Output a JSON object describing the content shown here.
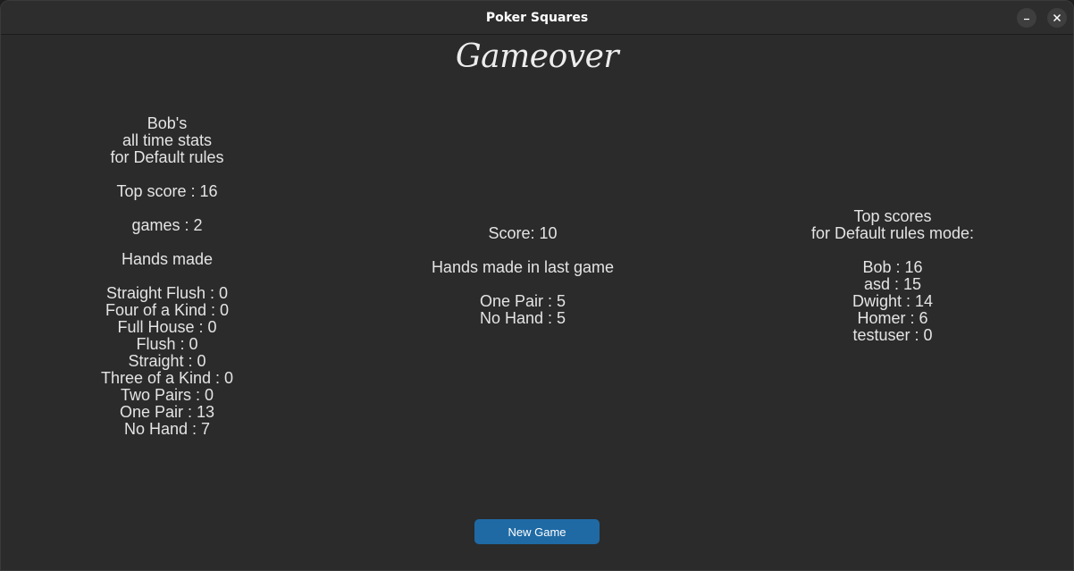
{
  "window": {
    "title": "Poker Squares"
  },
  "heading": "Gameover",
  "stats": {
    "header": [
      "Bob's",
      "all time stats",
      "for Default rules"
    ],
    "top_score": "Top score : 16",
    "games": "games : 2",
    "hands_made_label": "Hands made",
    "hands": [
      "Straight Flush : 0",
      "Four of a Kind : 0",
      "Full House : 0",
      "Flush : 0",
      "Straight : 0",
      "Three of a Kind : 0",
      "Two Pairs : 0",
      "One Pair : 13",
      "No Hand : 7"
    ]
  },
  "last_game": {
    "score": "Score: 10",
    "hands_label": "Hands made in last game",
    "hands": [
      "One Pair : 5",
      "No Hand : 5"
    ]
  },
  "top_scores": {
    "header": [
      "Top scores",
      "for Default rules mode:"
    ],
    "entries": [
      "Bob : 16",
      "asd : 15",
      "Dwight : 14",
      "Homer : 6",
      "testuser : 0"
    ]
  },
  "new_game_label": "New Game",
  "colors": {
    "background": "#2b2b2b",
    "text": "#e4e4e4",
    "button": "#1f6aa5"
  },
  "icons": {
    "minimize": "minimize-icon",
    "close": "close-icon"
  }
}
